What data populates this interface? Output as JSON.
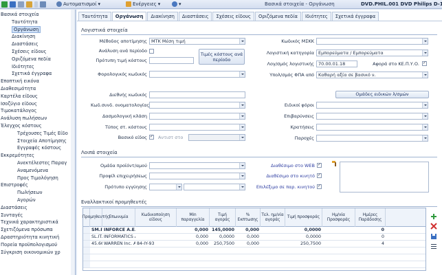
{
  "titlebar": {
    "menu_automation": "Αυτοματισμοί",
    "menu_actions": "Ενέργειες",
    "window_title": "Βασικά στοιχεία - Οργάνωση",
    "record_title": "DVD.PHIL.001 DVD Philips D-100"
  },
  "sidebar": {
    "items": [
      {
        "label": "Βασικά στοιχεία",
        "level": 0
      },
      {
        "label": "Ταυτότητα",
        "level": 1
      },
      {
        "label": "Οργάνωση",
        "level": 1,
        "selected": true
      },
      {
        "label": "Διακίνηση",
        "level": 1
      },
      {
        "label": "Διαστάσεις",
        "level": 1
      },
      {
        "label": "Σχέσεις είδους",
        "level": 1
      },
      {
        "label": "Οριζόμενα πεδία",
        "level": 1
      },
      {
        "label": "Ιδιότητες",
        "level": 1
      },
      {
        "label": "Σχετικά έγγραφα",
        "level": 1
      },
      {
        "label": "Εποπτική εικόνα",
        "level": 0
      },
      {
        "label": "Διαθεσιμότητα",
        "level": 0
      },
      {
        "label": "Καρτέλα είδους",
        "level": 0
      },
      {
        "label": "Ισοζύγιο είδους",
        "level": 0
      },
      {
        "label": "Τιμοκατάλογος",
        "level": 0
      },
      {
        "label": "Ανάλυση πωλήσεων",
        "level": 0
      },
      {
        "label": "Έλεγχος κόστους",
        "level": 0
      },
      {
        "label": "Τρέχουσες Τιμές Είδο",
        "level": 2
      },
      {
        "label": "Στοιχεία Αποτίμησης",
        "level": 2
      },
      {
        "label": "Εγγραφές κόστους",
        "level": 2
      },
      {
        "label": "Εκκρεμότητες",
        "level": 0
      },
      {
        "label": "Ανεκτέλεστες Παραγ",
        "level": 2
      },
      {
        "label": "Αναμενόμενα",
        "level": 2
      },
      {
        "label": "Προς Τιμολόγηση",
        "level": 2
      },
      {
        "label": "Επιστροφές",
        "level": 0
      },
      {
        "label": "Πωλήσεων",
        "level": 2
      },
      {
        "label": "Αγορών",
        "level": 2
      },
      {
        "label": "Διαστάσεις",
        "level": 0
      },
      {
        "label": "Συνταγές",
        "level": 0
      },
      {
        "label": "Τεχνικά χαρακτηριστικά",
        "level": 0
      },
      {
        "label": "Σχετιζόμενα πρόσωπα",
        "level": 0
      },
      {
        "label": "Δραστηριότητα κινητική",
        "level": 0
      },
      {
        "label": "Πορεία προϋπολογισμού",
        "level": 0
      },
      {
        "label": "Σύγκριση οικονομικών χρ",
        "level": 0
      }
    ]
  },
  "tabs": [
    "Ταυτότητα",
    "Οργάνωση",
    "Διακίνηση",
    "Διαστάσεις",
    "Σχέσεις είδους",
    "Οριζόμενα πεδία",
    "Ιδιότητες",
    "Σχετικά έγγραφα"
  ],
  "active_tab": "Οργάνωση",
  "accounting": {
    "section_title": "Λογιστικά στοιχεία",
    "valuation_method_label": "Μέθοδος αποτίμησης",
    "valuation_method_value": "ΜΤΚ Μέση τιμή",
    "analysis_per_period_label": "Ανάλυση ανά περίοδο",
    "cost_price_template_label": "Πρότυπη τιμή κόστους",
    "cost_per_period_button": "Τιμές κόστους ανά περίοδο",
    "tax_code_label": "Φορολογικός κωδικός",
    "mscc_code_label": "Κωδικός ΜΣΚΚ",
    "accounting_category_label": "Λογιστική κατηγορία",
    "accounting_category_value": "Εμπορεύματα / Εμπορεύματα",
    "gl_account_label": "Λογ/σμός λογιστικής",
    "gl_account_value": "70.00.01.18",
    "kepyo_label": "Αφορά στο ΚΕ.Π.Υ.Ο.",
    "vat_calc_label": "Υπολ/σμός ΦΠΑ από",
    "vat_calc_value": "Καθαρή αξία σε βασικό ν."
  },
  "codes": {
    "international_code_label": "Διεθνής κωδικός",
    "combined_nomenclature_label": "Κωδ.συνδ. ονοματολογίας",
    "customs_class_label": "Δασμολογική κλάση",
    "cost_type_label": "Τύπος στ. κόστους",
    "base_item_label": "Βασικό είδος",
    "corresponds_label": "Αντιστ στο"
  },
  "tax_groups": {
    "title": "Ομάδες ειδικών λ/σμών",
    "special_taxes_label": "Ειδικοί φόροι",
    "charges_label": "Επιβαρύνσεις",
    "withholdings_label": "Κρατήσεις",
    "benefits_label": "Παροχές"
  },
  "other": {
    "section_title": "Λοιπά στοιχεία",
    "product_group_label": "Ομάδα προϊόντ/αμού",
    "business_profile_label": "Προφίλ επιχειρήσεως",
    "warranty_template_label": "Πρότυπο εγγύησης",
    "available_web_label": "Διαθέσιμο στο WEB",
    "available_mobile_label": "Διαθέσιμο στο κινητό",
    "selected_mobile_label": "Επιλέξιμο σε παρ. κινητού"
  },
  "suppliers": {
    "section_title": "Εναλλακτικοί προμηθευτές",
    "columns": [
      "Προμηθευτής",
      "Επωνυμία",
      "Κωδικοποίηση είδους",
      "Min παραγγελία",
      "Τιμή αγοράς",
      "% Εκπτωσης",
      "Τελ. ημ/νία αγοράς",
      "Τιμή προσφοράς",
      "Ημ/νία Προσφοράς",
      "Ημέρες Παράδοσης"
    ],
    "rows": [
      {
        "supplier": "SM.IT.00102",
        "name": "INFORCE A.E.",
        "item_code": "",
        "min_order": "0,000",
        "purchase_price": "145,0000",
        "discount": "0,000",
        "last_purchase": "",
        "offer_price": "0,0000",
        "offer_date": "",
        "delivery_days": "0"
      },
      {
        "supplier": "SL.IT.00100",
        "name": "INFORMATICS A.E.",
        "item_code": "",
        "min_order": "0,000",
        "purchase_price": "0,0000",
        "discount": "0,000",
        "last_purchase": "",
        "offer_price": "0,0000",
        "offer_date": "",
        "delivery_days": "0"
      },
      {
        "supplier": "45.66.34",
        "name": "WARREN Inc. A...",
        "item_code": "84-IY-93",
        "min_order": "0,000",
        "purchase_price": "250,7500",
        "discount": "0,000",
        "last_purchase": "",
        "offer_price": "250,7500",
        "offer_date": "",
        "delivery_days": "4"
      }
    ]
  }
}
